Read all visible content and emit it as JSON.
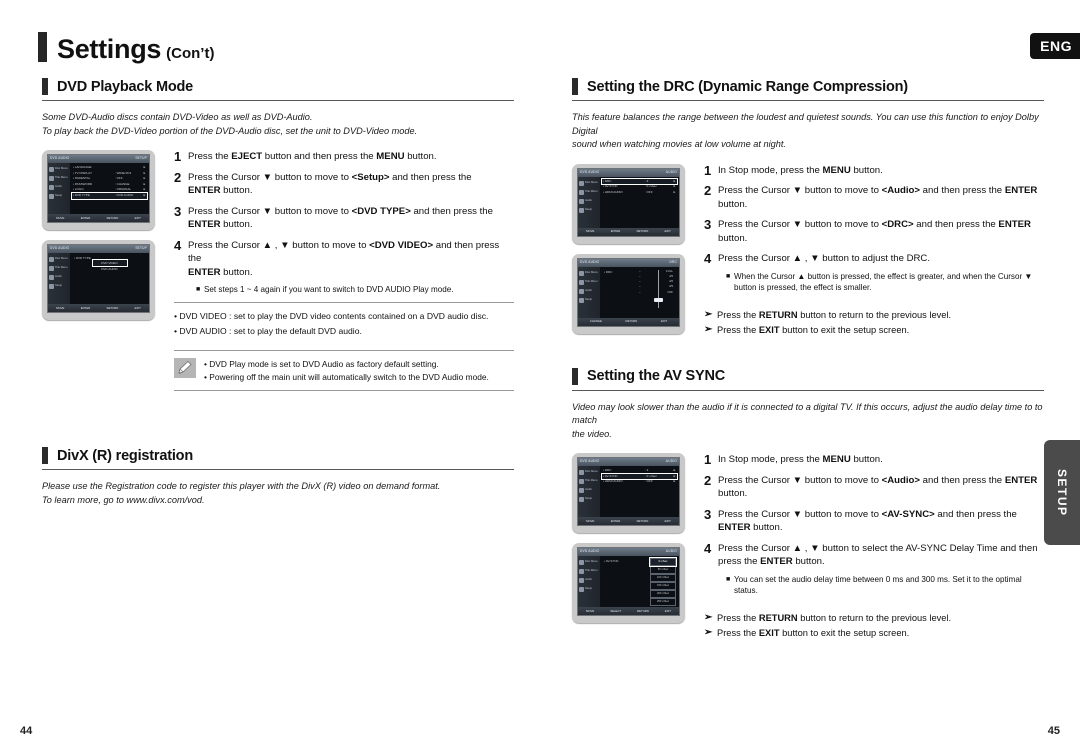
{
  "header": {
    "title": "Settings",
    "title_suffix": "(Con’t)",
    "language_tab": "ENG",
    "side_tab": "SETUP"
  },
  "footer": {
    "page_left": "44",
    "page_right": "45"
  },
  "sections": {
    "dvd_playback_mode": {
      "heading": "DVD Playback Mode",
      "intro_line1": "Some DVD-Audio discs contain DVD-Video as well as DVD-Audio.",
      "intro_line2": "To play back the DVD-Video portion of the DVD-Audio disc, set the unit to DVD-Video mode.",
      "steps": [
        {
          "num": "1",
          "html": "Press the <b>EJECT</b> button and then press the <b>MENU</b> button."
        },
        {
          "num": "2",
          "html": "Press the Cursor ▼ button to move to <b>&lt;Setup&gt;</b> and then press the<br><b>ENTER</b> button."
        },
        {
          "num": "3",
          "html": "Press the Cursor ▼ button to move to <b>&lt;DVD TYPE&gt;</b> and then press the<br><b>ENTER</b> button."
        },
        {
          "num": "4",
          "html": "Press the Cursor ▲ , ▼ button to move to <b>&lt;DVD VIDEO&gt;</b> and then press the<br><b>ENTER</b> button."
        }
      ],
      "sub_note": "Set steps 1 ~ 4 again if you want to switch to DVD AUDIO Play mode.",
      "bullets": [
        "• DVD VIDEO : set to play the DVD video contents contained on a DVD audio disc.",
        "• DVD AUDIO : set to play the default DVD audio."
      ],
      "note_box": [
        "• DVD Play mode is set to DVD Audio as factory default setting.",
        "• Powering off the main unit will automatically switch to the DVD Audio mode."
      ],
      "screen1": {
        "topbar_left": "DVD AUDIO",
        "topbar_right": "SETUP",
        "side_items": [
          "Disc Menu",
          "Title Menu",
          "Audio",
          "Setup"
        ],
        "rows": [
          {
            "k": "• LANGUAGE",
            "v": "",
            "arrow": "►",
            "highlight": false
          },
          {
            "k": "• TV DISPLAY",
            "v": ": WIDE/16:9",
            "arrow": "►",
            "highlight": false
          },
          {
            "k": "• PARENTAL",
            "v": ": OFF",
            "arrow": "►",
            "highlight": false
          },
          {
            "k": "• PASSWORD",
            "v": ": CHANGE",
            "arrow": "►",
            "highlight": false
          },
          {
            "k": "• LOGO",
            "v": ": ORIGINAL",
            "arrow": "►",
            "highlight": false
          },
          {
            "k": "• DVD TYPE",
            "v": ": DVD AUDIO",
            "arrow": "►",
            "highlight": true
          }
        ],
        "botbar": [
          "MOVE",
          "ENTER",
          "RETURN",
          "EXIT"
        ]
      },
      "screen2": {
        "topbar_left": "DVD AUDIO",
        "topbar_right": "SETUP",
        "side_items": [
          "Disc Menu",
          "Title Menu",
          "Audio",
          "Setup"
        ],
        "label_left": "• DVD TYPE",
        "options": [
          "DVD VIDEO",
          "DVD AUDIO"
        ],
        "selected_option": "DVD VIDEO",
        "botbar": [
          "MOVE",
          "ENTER",
          "RETURN",
          "EXIT"
        ]
      }
    },
    "divx_registration": {
      "heading": "DivX (R) registration",
      "intro_line1": "Please use the Registration code to register this player with the DivX (R) video on demand format.",
      "intro_line2": "To learn more, go to www.divx.com/vod."
    },
    "drc": {
      "heading": "Setting the DRC (Dynamic Range Compression)",
      "intro_line1": "This feature balances the range between the loudest and quietest sounds. You can use this function to enjoy Dolby Digital",
      "intro_line2": "sound when watching movies at low volume at night.",
      "steps": [
        {
          "num": "1",
          "html": "In Stop mode, press the <b>MENU</b> button."
        },
        {
          "num": "2",
          "html": "Press the Cursor ▼ button to move to <b>&lt;Audio&gt;</b> and then press the <b>ENTER</b> button."
        },
        {
          "num": "3",
          "html": "Press the Cursor ▼ button to move to <b>&lt;DRC&gt;</b> and then press the <b>ENTER</b> button."
        },
        {
          "num": "4",
          "html": "Press the Cursor ▲ , ▼ button to adjust the DRC."
        }
      ],
      "sub_note": "When the Cursor ▲ button is pressed, the effect is greater, and when the Cursor ▼ button is pressed, the effect is smaller.",
      "arrows": [
        "Press the <b>RETURN</b> button to return to the previous level.",
        "Press the <b>EXIT</b> button to exit the setup screen."
      ],
      "screen1": {
        "topbar_left": "DVD AUDIO",
        "topbar_right": "AUDIO",
        "side_items": [
          "Disc Menu",
          "Title Menu",
          "Audio",
          "Setup"
        ],
        "rows": [
          {
            "k": "• DRC",
            "v": ": 3",
            "arrow": "►",
            "highlight": true
          },
          {
            "k": "• AV-SYNC",
            "v": ": 0 mSec",
            "arrow": "►",
            "highlight": false
          },
          {
            "k": "• HDMI AUDIO",
            "v": ": OFF",
            "arrow": "►",
            "highlight": false
          }
        ],
        "botbar": [
          "MOVE",
          "ENTER",
          "RETURN",
          "EXIT"
        ]
      },
      "screen2": {
        "topbar_left": "DVD AUDIO",
        "topbar_right": "DRC",
        "side_items": [
          "Disc Menu",
          "Title Menu",
          "Audio",
          "Setup"
        ],
        "label_left": "• DRC",
        "levels": [
          "FULL",
          "4/5",
          "4/6",
          "3/5",
          "OFF"
        ],
        "botbar": [
          "CHANGE",
          "RETURN",
          "EXIT"
        ]
      }
    },
    "av_sync": {
      "heading": "Setting the AV SYNC",
      "intro_line1": "Video may look slower than the audio if it is connected to a digital TV. If this occurs, adjust the audio delay time to to match",
      "intro_line2": "the video.",
      "steps": [
        {
          "num": "1",
          "html": "In Stop mode, press the <b>MENU</b> button."
        },
        {
          "num": "2",
          "html": "Press the Cursor ▼ button to move to <b>&lt;Audio&gt;</b> and then press the <b>ENTER</b> button."
        },
        {
          "num": "3",
          "html": "Press the Cursor ▼ button to move to <b>&lt;AV-SYNC&gt;</b> and then press the<br><b>ENTER</b> button."
        },
        {
          "num": "4",
          "html": "Press the Cursor ▲ , ▼ button to select the AV-SYNC Delay Time  and then<br>press the <b>ENTER</b> button."
        }
      ],
      "sub_note": "You can set the audio delay time between 0 ms and 300 ms. Set it to the optimal status.",
      "arrows": [
        "Press the <b>RETURN</b> button to return to the previous level.",
        "Press the <b>EXIT</b> button to exit the setup screen."
      ],
      "screen1": {
        "topbar_left": "DVD AUDIO",
        "topbar_right": "AUDIO",
        "side_items": [
          "Disc Menu",
          "Title Menu",
          "Audio",
          "Setup"
        ],
        "rows": [
          {
            "k": "• DRC",
            "v": ": 3",
            "arrow": "►",
            "highlight": false
          },
          {
            "k": "• AV-SYNC",
            "v": ": 0 mSec",
            "arrow": "►",
            "highlight": true
          },
          {
            "k": "• HDMI AUDIO",
            "v": ": OFF",
            "arrow": "►",
            "highlight": false
          }
        ],
        "botbar": [
          "MOVE",
          "ENTER",
          "RETURN",
          "EXIT"
        ]
      },
      "screen2": {
        "topbar_left": "DVD AUDIO",
        "topbar_right": "AUDIO",
        "side_items": [
          "Disc Menu",
          "Title Menu",
          "Audio",
          "Setup"
        ],
        "label_left": "• AV-SYNC",
        "options": [
          "0 mSec",
          "50 mSec",
          "100 mSec",
          "150 mSec",
          "200 mSec",
          "250 mSec",
          "300 mSec"
        ],
        "selected_option": "0 mSec",
        "botbar": [
          "MOVE",
          "SELECT",
          "RETURN",
          "EXIT"
        ]
      }
    }
  }
}
